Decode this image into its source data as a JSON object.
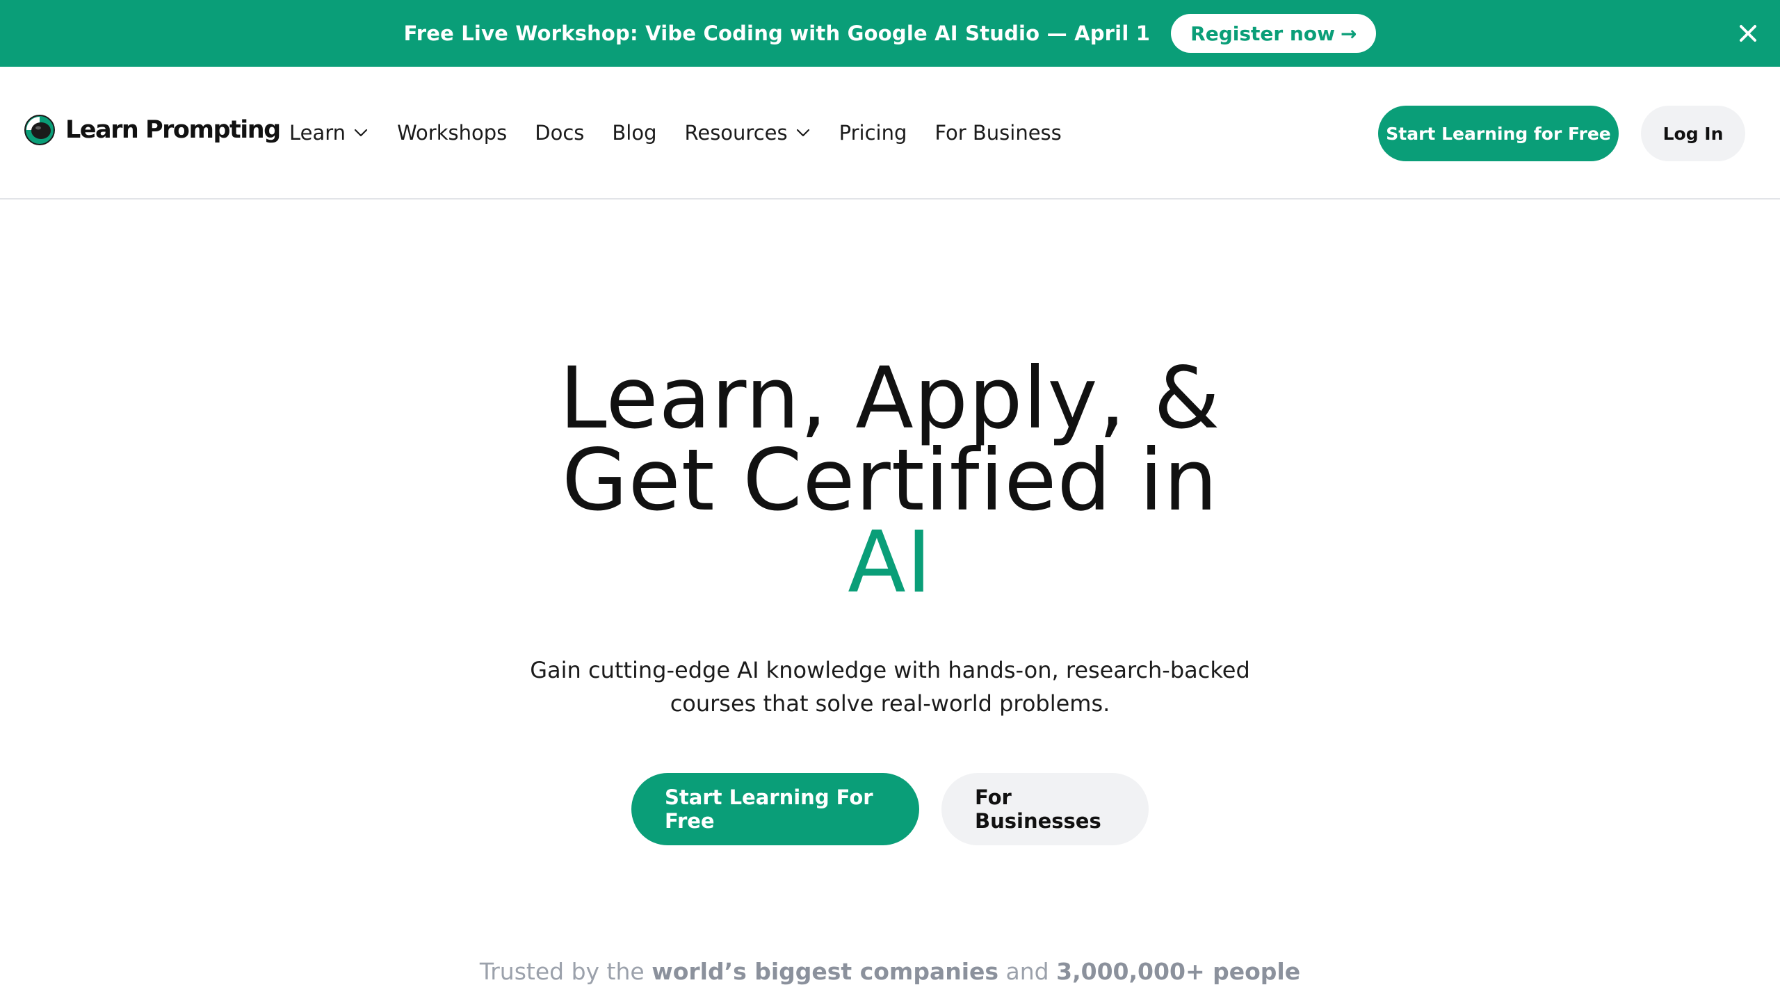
{
  "banner": {
    "text": "Free Live Workshop: Vibe Coding with Google AI Studio — April 1",
    "cta_label": "Register now",
    "cta_arrow": "→",
    "close_icon": "close-icon"
  },
  "header": {
    "logo_text": "Learn Prompting",
    "nav": [
      {
        "label": "Learn",
        "has_dropdown": true
      },
      {
        "label": "Workshops",
        "has_dropdown": false
      },
      {
        "label": "Docs",
        "has_dropdown": false
      },
      {
        "label": "Blog",
        "has_dropdown": false
      },
      {
        "label": "Resources",
        "has_dropdown": true
      },
      {
        "label": "Pricing",
        "has_dropdown": false
      },
      {
        "label": "For Business",
        "has_dropdown": false
      }
    ],
    "primary_cta": "Start Learning for Free",
    "login": "Log In"
  },
  "hero": {
    "title_line1": "Learn, Apply, &",
    "title_line2": "Get Certified in",
    "title_accent": "AI",
    "subtitle_line1": "Gain cutting-edge AI knowledge with hands-on, research-backed",
    "subtitle_line2": "courses that solve real-world problems.",
    "primary_cta": "Start Learning For Free",
    "secondary_cta": "For Businesses"
  },
  "trusted": {
    "prefix": "Trusted by the",
    "companies": "world’s biggest companies",
    "middle": "and",
    "people": "3,000,000+ people"
  },
  "colors": {
    "brand": "#0a9e78",
    "text": "#111111",
    "muted": "#9ba1ab",
    "secondary_button_bg": "#f1f2f4",
    "divider": "#e2e4e8"
  }
}
